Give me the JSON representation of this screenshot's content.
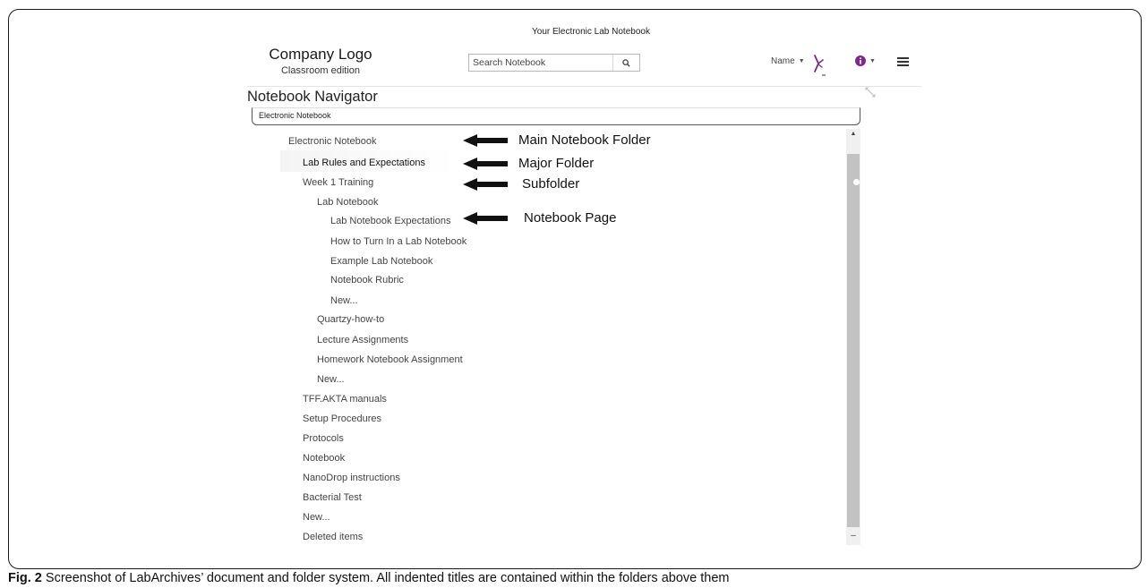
{
  "app": {
    "title": "Your Electronic Lab Notebook"
  },
  "logo": {
    "company": "Company Logo",
    "edition": "Classroom edition"
  },
  "search": {
    "placeholder": "Search Notebook"
  },
  "user": {
    "name": "Name"
  },
  "navigator": {
    "title": "Notebook Navigator",
    "breadcrumb": "Electronic Notebook"
  },
  "tree": [
    {
      "label": "Electronic Notebook"
    },
    {
      "label": "Lab Rules and Expectations"
    },
    {
      "label": "Week 1 Training"
    },
    {
      "label": "Lab Notebook"
    },
    {
      "label": "Lab Notebook Expectations"
    },
    {
      "label": "How to Turn In a Lab Notebook"
    },
    {
      "label": "Example Lab Notebook"
    },
    {
      "label": "Notebook Rubric"
    },
    {
      "label": "New..."
    },
    {
      "label": "Quartzy-how-to"
    },
    {
      "label": "Lecture Assignments"
    },
    {
      "label": "Homework Notebook Assignment"
    },
    {
      "label": "New..."
    },
    {
      "label": "TFF.AKTA manuals"
    },
    {
      "label": "Setup Procedures"
    },
    {
      "label": "Protocols"
    },
    {
      "label": "Notebook"
    },
    {
      "label": "NanoDrop instructions"
    },
    {
      "label": "Bacterial Test"
    },
    {
      "label": "New..."
    },
    {
      "label": "Deleted items"
    }
  ],
  "annotations": {
    "main": "Main Notebook Folder",
    "major": "Major Folder",
    "sub": "Subfolder",
    "page": "Notebook Page"
  },
  "caption": {
    "label": "Fig. 2",
    "text": " Screenshot of LabArchives’ document and folder system. All indented titles are contained within the folders above them"
  },
  "colors": {
    "accent": "#7b2a8a",
    "scroll_thumb": "#c2c2c2"
  },
  "icons": [
    "search-icon",
    "sign-language-icon",
    "info-icon",
    "menu-icon",
    "resize-icon",
    "arrow-left-icon"
  ]
}
